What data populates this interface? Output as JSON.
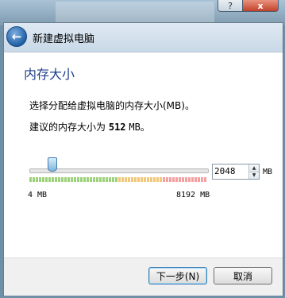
{
  "window": {
    "title": "新建虚拟电脑",
    "help_glyph": "?",
    "close_glyph": "x"
  },
  "page": {
    "heading": "内存大小",
    "description": "选择分配给虚拟电脑的内存大小(MB)。",
    "recommend_prefix": "建议的内存大小为",
    "recommend_value": "512",
    "recommend_suffix": "MB。"
  },
  "memory": {
    "value": "2048",
    "unit": "MB",
    "slider_min": 4,
    "slider_max": 8192,
    "slider_value": 2048,
    "min_label": "4 MB",
    "max_label": "8192 MB",
    "zones": {
      "green_until_fraction": 0.5,
      "orange_until_fraction": 0.75
    },
    "zone_colors": {
      "green": "#9bd27a",
      "orange": "#f2c77a",
      "red": "#f3a0a0"
    }
  },
  "buttons": {
    "next_label": "下一步(N)",
    "cancel_label": "取消"
  },
  "icons": {
    "back": "back-arrow-icon",
    "spin_up": "chevron-up-icon",
    "spin_down": "chevron-down-icon"
  },
  "colors": {
    "heading": "#1e3f8a",
    "accent": "#3c7fb1"
  }
}
